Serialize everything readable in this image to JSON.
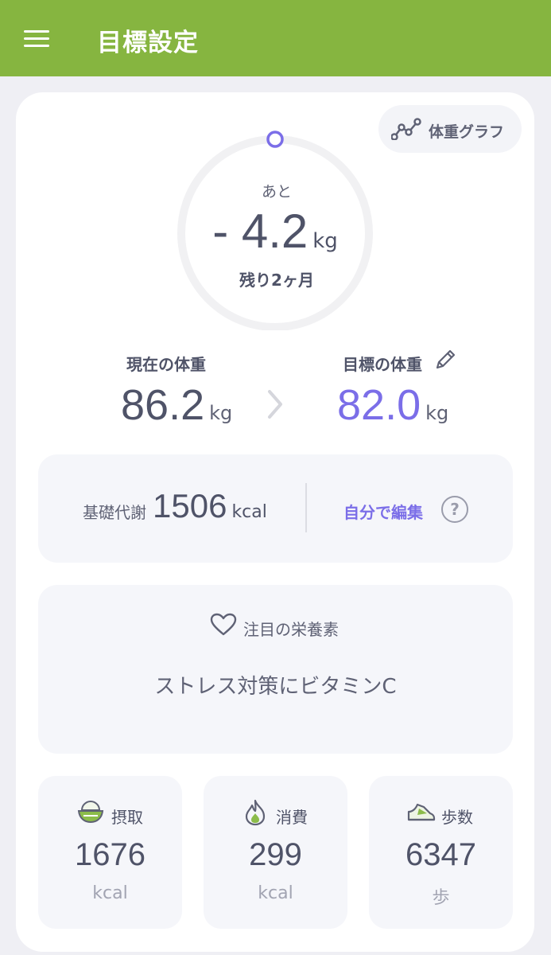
{
  "header": {
    "title": "目標設定"
  },
  "graph_button": {
    "label": "体重グラフ"
  },
  "remaining": {
    "prefix": "あと",
    "value": "- 4.2",
    "unit": "kg",
    "period": "残り2ヶ月"
  },
  "current_weight": {
    "label": "現在の体重",
    "value": "86.2",
    "unit": "kg"
  },
  "target_weight": {
    "label": "目標の体重",
    "value": "82.0",
    "unit": "kg"
  },
  "bmr": {
    "label": "基礎代謝",
    "value": "1506",
    "unit": "kcal",
    "edit_label": "自分で編集",
    "help": "?"
  },
  "nutrient": {
    "title": "注目の栄養素",
    "text": "ストレス対策にビタミンC"
  },
  "stats": [
    {
      "label": "摂取",
      "value": "1676",
      "unit": "kcal",
      "icon": "rice-bowl-icon"
    },
    {
      "label": "消費",
      "value": "299",
      "unit": "kcal",
      "icon": "flame-icon"
    },
    {
      "label": "歩数",
      "value": "6347",
      "unit": "歩",
      "icon": "sneaker-icon"
    }
  ],
  "colors": {
    "header": "#86b540",
    "accent": "#7b6ee8",
    "text": "#4f5368",
    "panel": "#f5f6fa"
  }
}
